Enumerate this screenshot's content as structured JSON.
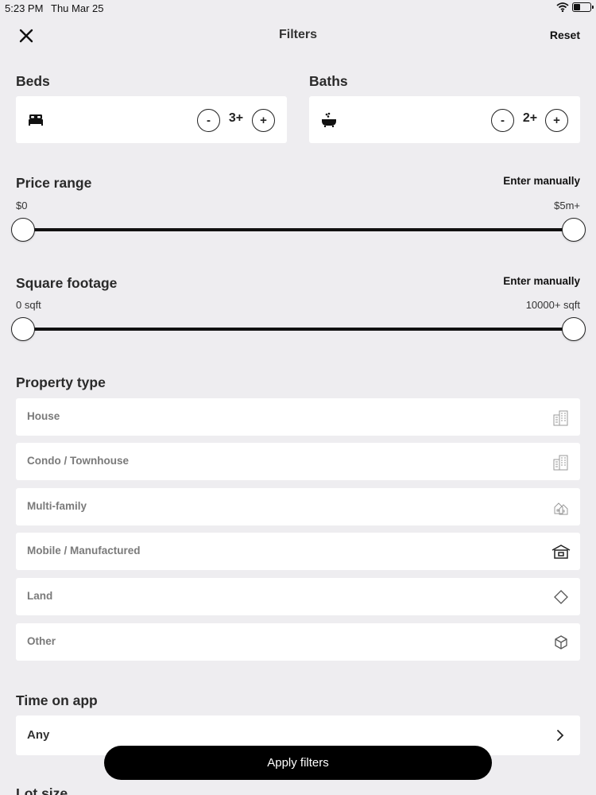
{
  "status_bar": {
    "time": "5:23 PM",
    "date": "Thu Mar 25",
    "battery_level": 0.4
  },
  "header": {
    "title": "Filters",
    "reset_label": "Reset"
  },
  "beds": {
    "title": "Beds",
    "value": "3+",
    "minus": "-",
    "plus": "+",
    "icon": "bed-icon"
  },
  "baths": {
    "title": "Baths",
    "value": "2+",
    "minus": "-",
    "plus": "+",
    "icon": "bathtub-icon"
  },
  "price_range": {
    "title": "Price range",
    "enter_manually": "Enter manually",
    "min_label": "$0",
    "max_label": "$5m+",
    "min_fraction": 0,
    "max_fraction": 1
  },
  "square_footage": {
    "title": "Square footage",
    "enter_manually": "Enter manually",
    "min_label": "0 sqft",
    "max_label": "10000+ sqft",
    "min_fraction": 0,
    "max_fraction": 1
  },
  "property_type": {
    "title": "Property type",
    "items": [
      {
        "label": "House",
        "icon": "building-icon"
      },
      {
        "label": "Condo / Townhouse",
        "icon": "building-icon"
      },
      {
        "label": "Multi-family",
        "icon": "multi-family-icon"
      },
      {
        "label": "Mobile / Manufactured",
        "icon": "mobile-home-icon"
      },
      {
        "label": "Land",
        "icon": "land-diamond-icon"
      },
      {
        "label": "Other",
        "icon": "cube-icon"
      }
    ]
  },
  "time_on_app": {
    "title": "Time on app",
    "value": "Any"
  },
  "apply_label": "Apply filters",
  "lot_size": {
    "title": "Lot size"
  },
  "colors": {
    "background": "#eeedf0",
    "card": "#ffffff",
    "accent": "#000000",
    "muted_text": "#7a7a7a"
  }
}
